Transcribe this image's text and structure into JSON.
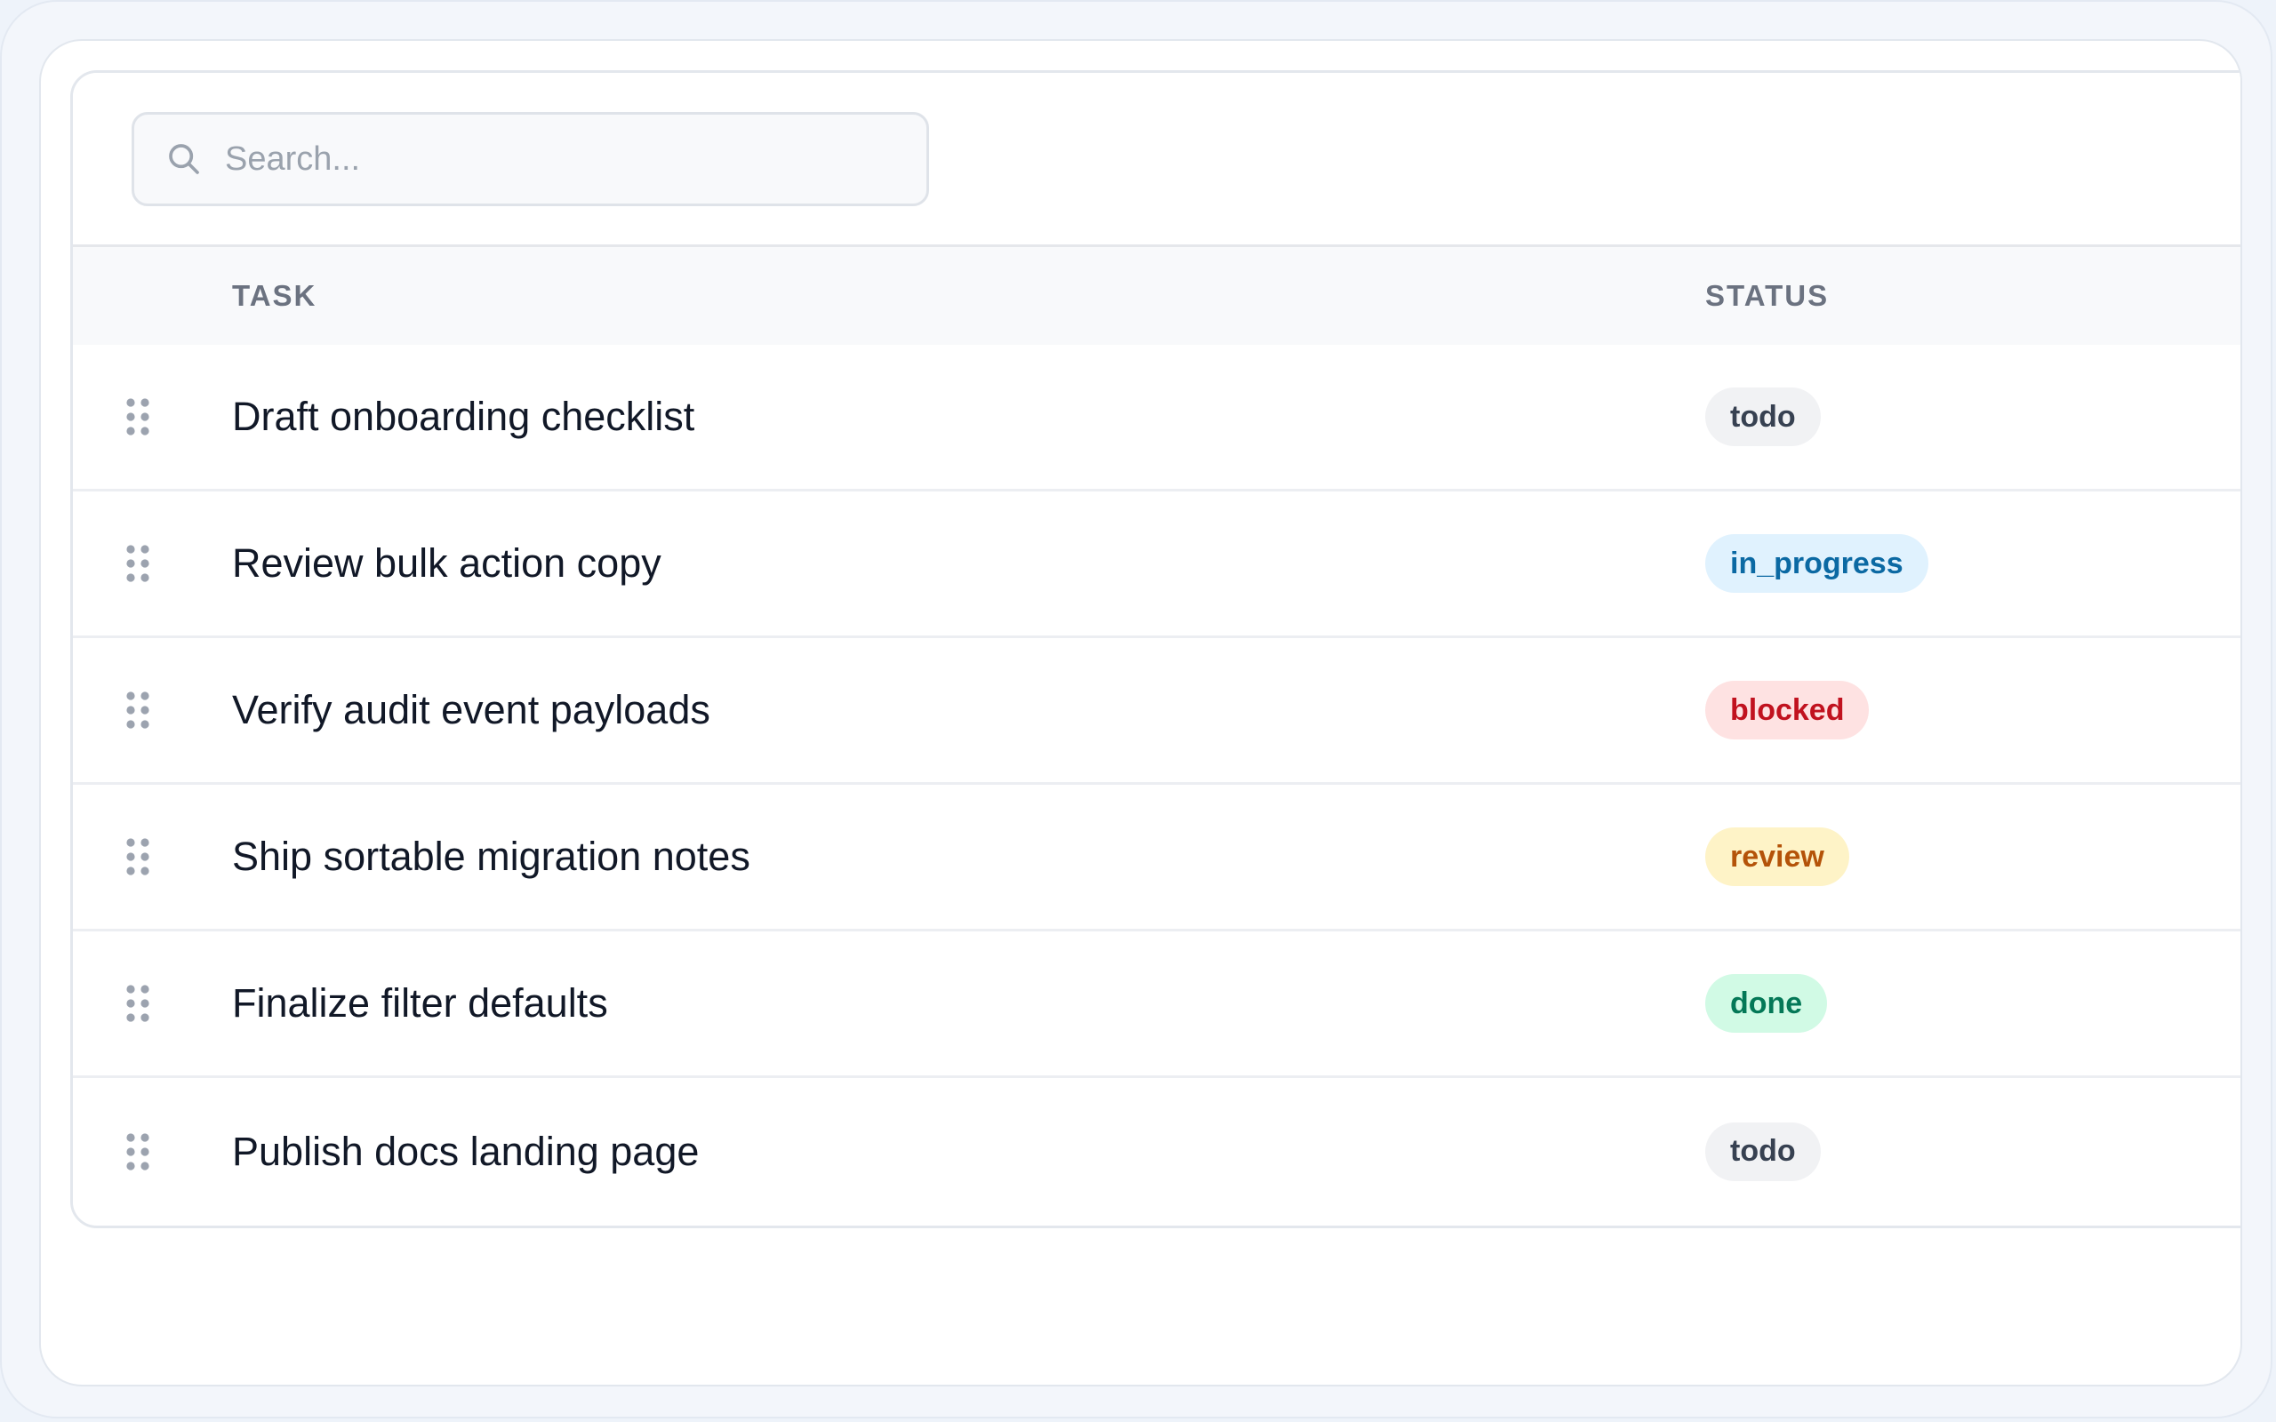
{
  "search": {
    "placeholder": "Search...",
    "value": ""
  },
  "columns": {
    "task": "TASK",
    "status": "STATUS"
  },
  "rows": [
    {
      "task": "Draft onboarding checklist",
      "status": "todo",
      "badge_bg": "#f1f2f4",
      "badge_fg": "#374151"
    },
    {
      "task": "Review bulk action copy",
      "status": "in_progress",
      "badge_bg": "#e0f2fe",
      "badge_fg": "#0b69a3"
    },
    {
      "task": "Verify audit event payloads",
      "status": "blocked",
      "badge_bg": "#fee2e2",
      "badge_fg": "#c1121f"
    },
    {
      "task": "Ship sortable migration notes",
      "status": "review",
      "badge_bg": "#fef3c7",
      "badge_fg": "#b45309"
    },
    {
      "task": "Finalize filter defaults",
      "status": "done",
      "badge_bg": "#d1fae5",
      "badge_fg": "#047857"
    },
    {
      "task": "Publish docs landing page",
      "status": "todo",
      "badge_bg": "#f1f2f4",
      "badge_fg": "#374151"
    }
  ],
  "icons": {
    "search": "search-icon",
    "drag": "drag-handle-icon"
  }
}
